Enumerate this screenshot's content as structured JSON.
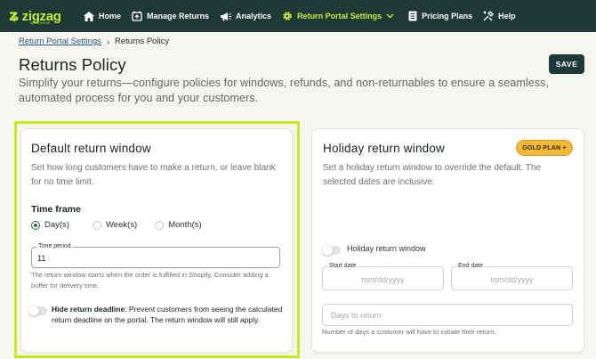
{
  "brand": {
    "name": "zigzag",
    "sub": "by RESOLVE",
    "accent": "#c7ec3c",
    "nav_bg": "#1f3a34"
  },
  "nav": {
    "items": [
      {
        "label": "Home",
        "icon": "home-icon"
      },
      {
        "label": "Manage Returns",
        "icon": "returns-box-icon"
      },
      {
        "label": "Analytics",
        "icon": "megaphone-icon"
      },
      {
        "label": "Return Portal Settings",
        "icon": "gear-icon",
        "active": true
      },
      {
        "label": "Pricing Plans",
        "icon": "list-document-icon"
      },
      {
        "label": "Help",
        "icon": "tools-help-icon"
      }
    ]
  },
  "breadcrumb": {
    "parent": "Return Portal Settings",
    "current": "Returns Policy"
  },
  "header": {
    "title": "Returns Policy",
    "description": "Simplify your returns—configure policies for windows, refunds, and non-returnables to ensure a seamless, automated process for you and your customers.",
    "save_label": "SAVE"
  },
  "default_window": {
    "title": "Default return window",
    "description": "Set how long customers have to make a return, or leave blank for no time limit.",
    "timeframe_label": "Time frame",
    "options": [
      "Day(s)",
      "Week(s)",
      "Month(s)"
    ],
    "selected_option": "Day(s)",
    "time_period_label": "Time period",
    "time_period_value": "11",
    "helper": "The return window starts when the order is fulfilled in Shopify. Consider adding a buffer for delivery time.",
    "hide_deadline_label": "Hide return deadline",
    "hide_deadline_text": ": Prevent customers from seeing the calculated return deadline on the portal. The return window will still apply.",
    "hide_deadline_enabled": false
  },
  "holiday_window": {
    "title": "Holiday return window",
    "badge": "GOLD PLAN +",
    "description": "Set a holiday return window to override the default. The selected dates are inclusive.",
    "toggle_label": "Holiday return window",
    "toggle_enabled": false,
    "start_label": "Start date",
    "start_placeholder": "mm/dd/yyyy",
    "end_label": "End date",
    "end_placeholder": "mm/dd/yyyy",
    "days_placeholder": "Days to return",
    "days_helper": "Number of days a customer will have to initiate their return."
  }
}
